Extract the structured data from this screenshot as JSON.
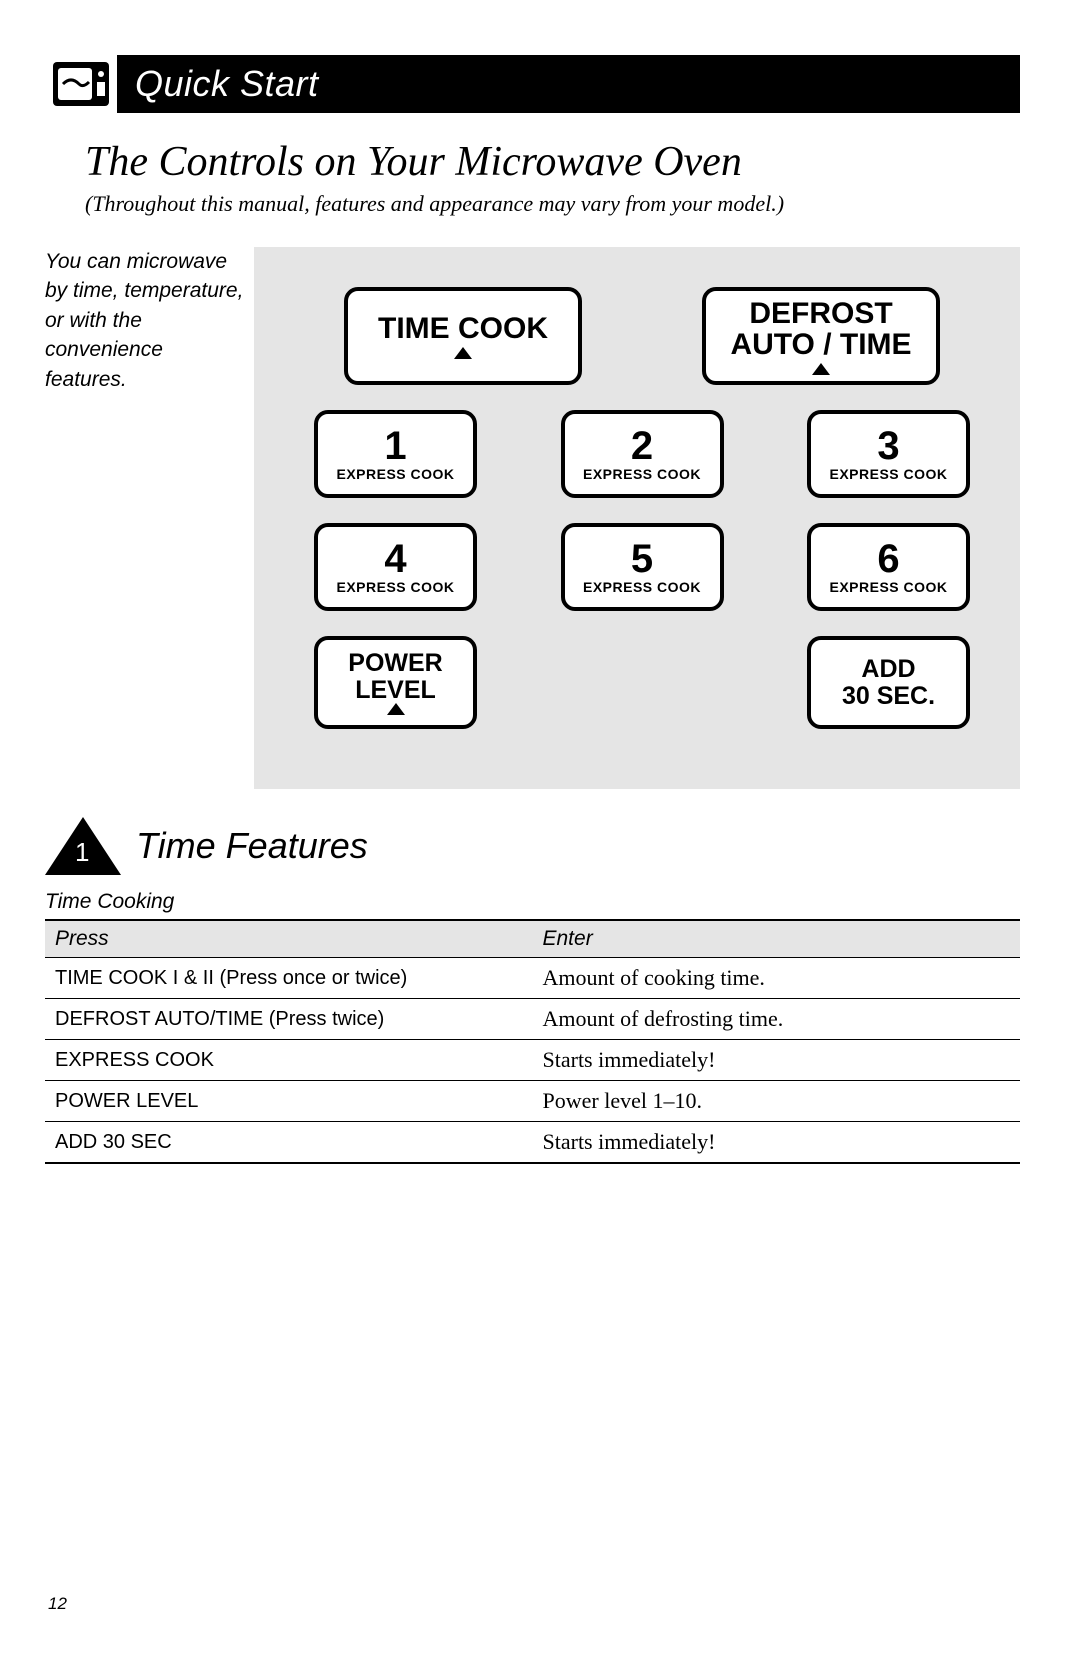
{
  "header": {
    "title": "Quick Start"
  },
  "main_title": "The Controls on Your Microwave Oven",
  "sub_note": "(Throughout this manual, features and appearance may vary from your model.)",
  "side_text": "You can microwave by time, temperature, or with the convenience features.",
  "panel": {
    "time_cook": "TIME COOK",
    "defrost_l1": "DEFROST",
    "defrost_l2": "AUTO / TIME",
    "express_label": "EXPRESS COOK",
    "nums": [
      "1",
      "2",
      "3",
      "4",
      "5",
      "6"
    ],
    "power_l1": "POWER",
    "power_l2": "LEVEL",
    "add_l1": "ADD",
    "add_l2": "30 SEC."
  },
  "section": {
    "marker": "1",
    "title": "Time Features"
  },
  "table": {
    "caption": "Time Cooking",
    "col_press": "Press",
    "col_enter": "Enter",
    "rows": [
      {
        "press": "TIME COOK I & II (Press once or twice)",
        "enter": "Amount of cooking time."
      },
      {
        "press": "DEFROST AUTO/TIME (Press twice)",
        "enter": "Amount of defrosting time."
      },
      {
        "press": "EXPRESS COOK",
        "enter": "Starts immediately!"
      },
      {
        "press": "POWER LEVEL",
        "enter": "Power level 1–10."
      },
      {
        "press": "ADD 30 SEC",
        "enter": "Starts immediately!"
      }
    ]
  },
  "page_number": "12"
}
